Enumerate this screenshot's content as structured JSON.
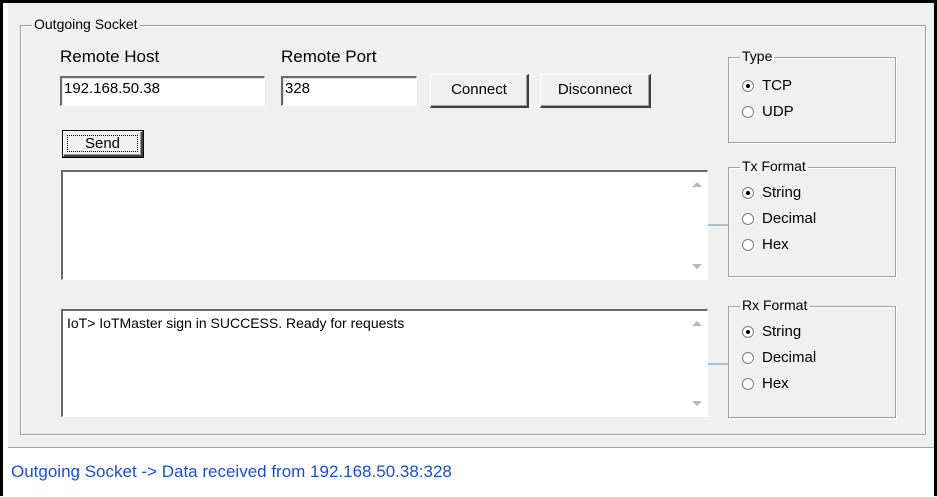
{
  "outgoing": {
    "title": "Outgoing Socket",
    "remote_host_label": "Remote Host",
    "remote_host_value": "192.168.50.38",
    "remote_port_label": "Remote Port",
    "remote_port_value": "328",
    "connect_label": "Connect",
    "disconnect_label": "Disconnect",
    "send_label": "Send",
    "tx_text": "",
    "rx_text": "IoT> IoTMaster sign in SUCCESS. Ready for requests"
  },
  "type_group": {
    "title": "Type",
    "options": [
      {
        "label": "TCP",
        "selected": true
      },
      {
        "label": "UDP",
        "selected": false
      }
    ]
  },
  "tx_format": {
    "title": "Tx Format",
    "options": [
      {
        "label": "String",
        "selected": true
      },
      {
        "label": "Decimal",
        "selected": false
      },
      {
        "label": "Hex",
        "selected": false
      }
    ]
  },
  "rx_format": {
    "title": "Rx Format",
    "options": [
      {
        "label": "String",
        "selected": true
      },
      {
        "label": "Decimal",
        "selected": false
      },
      {
        "label": "Hex",
        "selected": false
      }
    ]
  },
  "status": {
    "text": "Outgoing Socket -> Data received from 192.168.50.38:328"
  },
  "colors": {
    "status_text": "#1a4ed8",
    "panel_bg": "#f0f0f0"
  }
}
